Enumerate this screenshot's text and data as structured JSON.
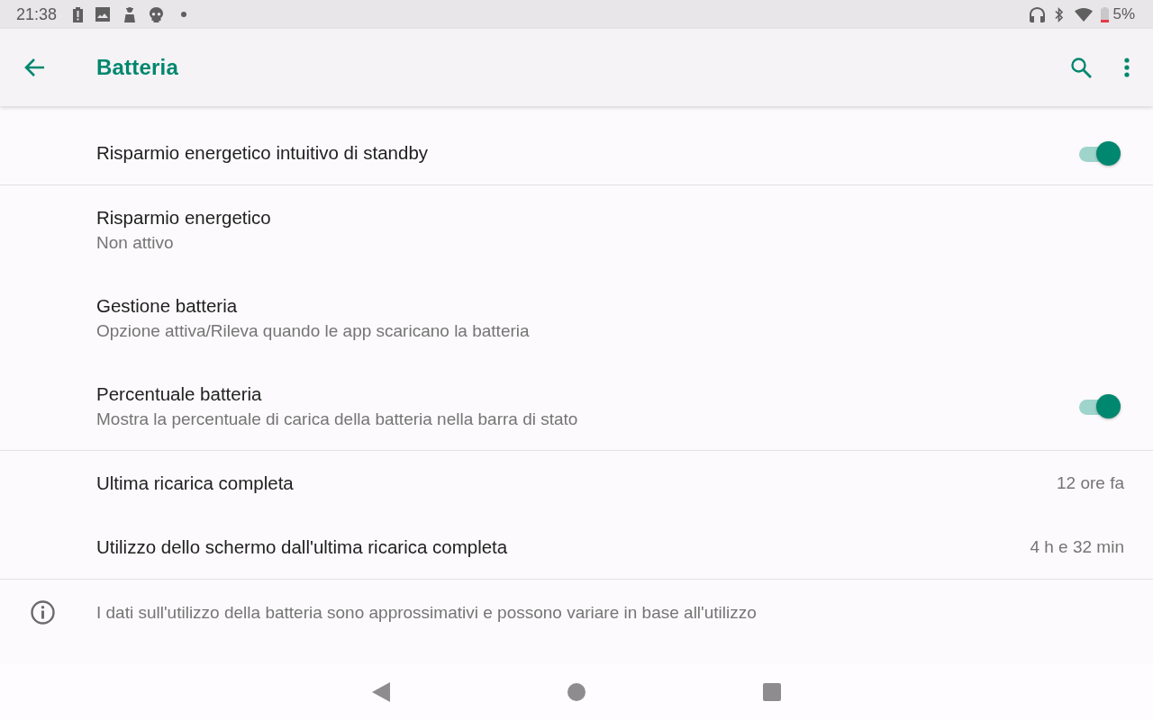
{
  "status_bar": {
    "time": "21:38",
    "battery_text": "5%"
  },
  "app_bar": {
    "title": "Batteria"
  },
  "sections": [
    {
      "items": [
        {
          "kind": "switch",
          "title": "Risparmio energetico intuitivo di standby",
          "on": true
        }
      ]
    },
    {
      "items": [
        {
          "kind": "text",
          "title": "Risparmio energetico",
          "summary": "Non attivo"
        },
        {
          "kind": "text",
          "title": "Gestione batteria",
          "summary": "Opzione attiva/Rileva quando le app scaricano la batteria"
        },
        {
          "kind": "switch",
          "title": "Percentuale batteria",
          "summary": "Mostra la percentuale di carica della batteria nella barra di stato",
          "on": true
        }
      ]
    },
    {
      "items": [
        {
          "kind": "value",
          "title": "Ultima ricarica completa",
          "value": "12 ore fa"
        },
        {
          "kind": "value",
          "title": "Utilizzo dello schermo dall'ultima ricarica completa",
          "value": "4 h e 32 min"
        }
      ]
    }
  ],
  "footer": {
    "text": "I dati sull'utilizzo della batteria sono approssimativi e possono variare in base all'utilizzo"
  }
}
